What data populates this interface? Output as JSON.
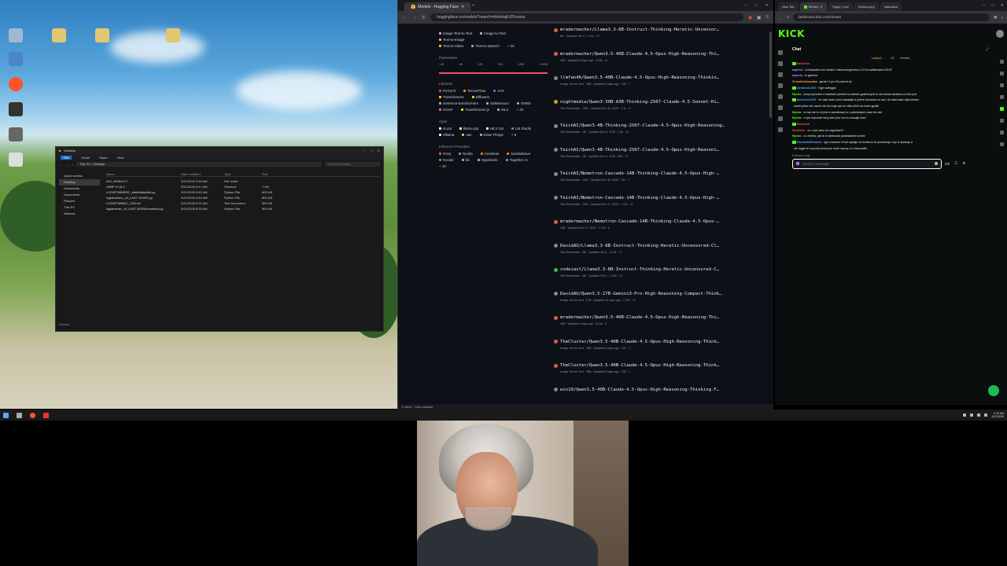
{
  "explorer": {
    "title": "Desktop",
    "ribbon": [
      "File",
      "Home",
      "Share",
      "View"
    ],
    "path": "This PC › Desktop",
    "search_placeholder": "Search Desktop",
    "nav": [
      "Quick access",
      "Desktop",
      "Downloads",
      "Documents",
      "Pictures",
      "This PC",
      "Network"
    ],
    "columns": [
      "Name",
      "Date modified",
      "Type",
      "Size"
    ],
    "files": [
      {
        "name": "AGI_MONOLIT",
        "date": "3/21/2026 3:48 AM",
        "type": "File folder",
        "size": ""
      },
      {
        "name": "GIMP 3.0.8-2",
        "date": "3/21/2026 5:47 AM",
        "type": "Shortcut",
        "size": "2 KB"
      },
      {
        "name": "LOGISTMINERC_###########.py",
        "date": "3/21/2026 5:52 AM",
        "type": "Python File",
        "size": "803 KB"
      },
      {
        "name": "logistminerc_v3_LAST WORK.py",
        "date": "3/21/2026 4:53 AM",
        "type": "Python File",
        "size": "803 KB"
      },
      {
        "name": "LOGISTMINEC_LOG.txt",
        "date": "3/21/2026 6:31 AM",
        "type": "Text Document",
        "size": "550 KB"
      },
      {
        "name": "logistminer_v3_LAST WORKnewfixed.py",
        "date": "3/21/2026 5:33 AM",
        "type": "Python File",
        "size": "803 KB"
      }
    ],
    "status": "6 items"
  },
  "browser1": {
    "tab": "Models - Hugging Face",
    "url": "huggingface.co/models?search=thinking%20cesso",
    "filters": {
      "tasks": [
        "Image-Text-to-Text",
        "Image-to-Text",
        "Text-to-Image",
        "Text-to-Video",
        "Text-to-Speech",
        "+ 44"
      ],
      "params_label": "Parameters",
      "params_ticks": [
        "<1B",
        "6B",
        "12B",
        "32B",
        "128B",
        ">500B"
      ],
      "libraries_label": "Libraries",
      "libraries": [
        "PyTorch",
        "TensorFlow",
        "JAX",
        "Transformers",
        "Diffusers",
        "sentence-transformers",
        "Safetensors",
        "ONNX",
        "GGUF",
        "Transformers.js",
        "MLX",
        "+ 42"
      ],
      "apps_label": "Apps",
      "apps": [
        "vLLM",
        "llama.cpp",
        "MLX LM",
        "LM Studio",
        "Ollama",
        "Jan",
        "Draw Things",
        "+ 8"
      ],
      "providers_label": "Inference Providers",
      "providers": [
        "Groq",
        "Novita",
        "Cerebras",
        "SambaNova",
        "Nscale",
        "fal",
        "Hyperbolic",
        "Together AI",
        "+ 10"
      ]
    },
    "models": [
      {
        "name": "mradermacher/Llama3.3-8B-Instruct-Thinking-Heretic-Uncensor…",
        "meta": "8B · Updated Jan 3 · 1.11k · 27",
        "color": "#e05d44"
      },
      {
        "name": "mradermacher/Qwen3.5-40B-Claude-4.5-Opus-High-Reasoning-Thi…",
        "meta": "40B · Updated 8 days ago · 3.53k · 11",
        "color": "#e05d44"
      },
      {
        "name": "llmfan46/Qwen3.5-40B-Claude-4.5-Opus-High-Reasoning-Thinkin…",
        "meta": "Image-Text-to-Text · 40B · Updated 6 days ago · 140 · 7",
        "color": "#888"
      },
      {
        "name": "nightmedia/Qwen3-30B-A3B-Thinking-2507-Claude-4.5-Sonnet-Hi…",
        "meta": "Text Generation · 31B · Updated Nov 16, 2025 · 1.1k · 5",
        "color": "#d4a017"
      },
      {
        "name": "TeichAI/Qwen3-4B-Thinking-2507-Claude-4.5-Opus-High-Reasoning…",
        "meta": "Text Generation · 4B · Updated Dec 3, 2025 · 1.5k · 41",
        "color": "#888"
      },
      {
        "name": "TeichAI/Qwen3-4B-Thinking-2507-Claude-4.5-Opus-High-Reasoni…",
        "meta": "Text Generation · 4B · Updated Dec 9, 2025 · 655 · 17",
        "color": "#888"
      },
      {
        "name": "TeichAI/Nemotron-Cascade-14B-Thinking-Claude-4.5-Opus-High-…",
        "meta": "Text Generation · 14B · Updated Dec 16, 2025 · 344 · 7",
        "color": "#888"
      },
      {
        "name": "TeichAI/Nemotron-Cascade-14B-Thinking-Claude-4.5-Opus-High-…",
        "meta": "Text Generation · 14B · Updated Dec 17, 2025 · 1.41k · 11",
        "color": "#888"
      },
      {
        "name": "mradermacher/Nemotron-Cascade-14B-Thinking-Claude-4.5-Opus-…",
        "meta": "14B · Updated Dec 17, 2025 · 1.37k · 5",
        "color": "#e05d44"
      },
      {
        "name": "DavidAU/Llama3.3-8B-Instruct-Thinking-Heretic-Uncensored-Cl…",
        "meta": "Text Generation · 8B · Updated Jan 3 · 1.13k · 17",
        "color": "#888"
      },
      {
        "name": "codeiavl/Llama3.3-8B-Instruct-Thinking-Heretic-Uncensored-C…",
        "meta": "Text Generation · 8B · Updated Feb 1 · 4.35k · 11",
        "color": "#3fb950"
      },
      {
        "name": "DavidAU/Qwen3.5-27B-Gemini3-Pro-High-Reasoning-Compact-Think…",
        "meta": "Image-Text-to-Text · 27B · Updated 10 days ago · 2.19k · 14",
        "color": "#888"
      },
      {
        "name": "mradermacher/Qwen3.5-40B-Claude-4.5-Opus-High-Reasoning-Thi…",
        "meta": "40B · Updated 4 days ago · 5.64k · 6",
        "color": "#e05d44"
      },
      {
        "name": "TheCluster/Qwen3.5-40B-Claude-4.5-Opus-High-Reasoning-Think…",
        "meta": "Image-Text-to-Text · 39B · Updated 5 days ago · 231 · 1",
        "color": "#e05d44"
      },
      {
        "name": "TheCluster/Qwen3.5-40B-Claude-4.5-Opus-High-Reasoning-Think…",
        "meta": "Image-Text-to-Text · 39B · Updated 5 days ago · 233 · 1",
        "color": "#e05d44"
      },
      {
        "name": "win10/Qwen3.5-40B-Claude-4.5-Opus-High-Reasoning-Thinking-F…",
        "meta": "",
        "color": "#888"
      }
    ],
    "status": "71 items · 1 item selected"
  },
  "browser2": {
    "tabs": [
      "New Tab",
      "Stream",
      "Tipply | Live",
      "Kickbot.app",
      "kakbotkot"
    ],
    "url": "dashboard.kick.com/stream",
    "logo": "KICK",
    "chat_title": "Chat",
    "pinned": [
      "Lucky1...",
      "13",
      "/moms"
    ],
    "messages": [
      {
        "user": "fanderivo",
        "text": "",
        "ucolor": "#ff4d4d"
      },
      {
        "user": "aspreio:",
        "text": "a testowales ten model? misbonne/gemma-3-27b-it-abliterated-GGUF",
        "ucolor": "#b68cff"
      },
      {
        "user": "aspreio:",
        "text": "to gemma",
        "ucolor": "#b68cff"
      },
      {
        "user": "ZronoDzieksandra:",
        "text": "gemini 3 pro 25 potrwil xd",
        "ucolor": "#ff9f43"
      },
      {
        "user": "alesmeck1200:",
        "text": "high solfeggio",
        "ucolor": "#4da3ff"
      },
      {
        "user": "Mycko:",
        "text": "pozyczaj sobie o kosztach pamieci w kartach graficznych to sie kurwa zdziwisz co tem jest",
        "ucolor": "#53fc18"
      },
      {
        "user": "alesmeck1200:",
        "text": "mi cały czasz print nawalaja a potem tlumacza na aqi i do data base daje jebane",
        "ucolor": "#4da3ff"
      },
      {
        "user": "",
        "text": "cwele jebac ich nawet sie nie kryje jak mi robie plinti na moim gpufie",
        "ucolor": "#ddd"
      },
      {
        "user": "Mycko:",
        "text": "no tak sie to mi jest w pamieciach a o pamieciach malo kto wie",
        "ucolor": "#53fc18"
      },
      {
        "user": "Mycko:",
        "text": "o tym szponcie ktory tam jest i za to uciszaja ludzi",
        "ucolor": "#53fc18"
      },
      {
        "user": "fanderivo",
        "text": "",
        "ucolor": "#ff4d4d"
      },
      {
        "user": "fanderivo:",
        "text": "co z tym ciew ai z agentami?",
        "ucolor": "#ff4d4d"
      },
      {
        "user": "Mycko:",
        "text": "co zrobisz, jak to w wieksosci podstawione plonki",
        "ucolor": "#53fc18"
      },
      {
        "user": "DamianNaPowiem:",
        "text": "Igor czasami mi sie wydaje ze trzeba te AI pierdolnąć i żyć w spokoju a",
        "ucolor": "#4da3ff"
      },
      {
        "user": "",
        "text": "nie ciągle te szponty kurwa już mnie męczą ci z microsoftu",
        "ucolor": "#ddd"
      }
    ],
    "followers_only": "Followers only",
    "input_placeholder": "Send a message",
    "counter": "0/0"
  },
  "taskbar": {
    "time": "6:29 AM",
    "date": "3/21/2026"
  }
}
